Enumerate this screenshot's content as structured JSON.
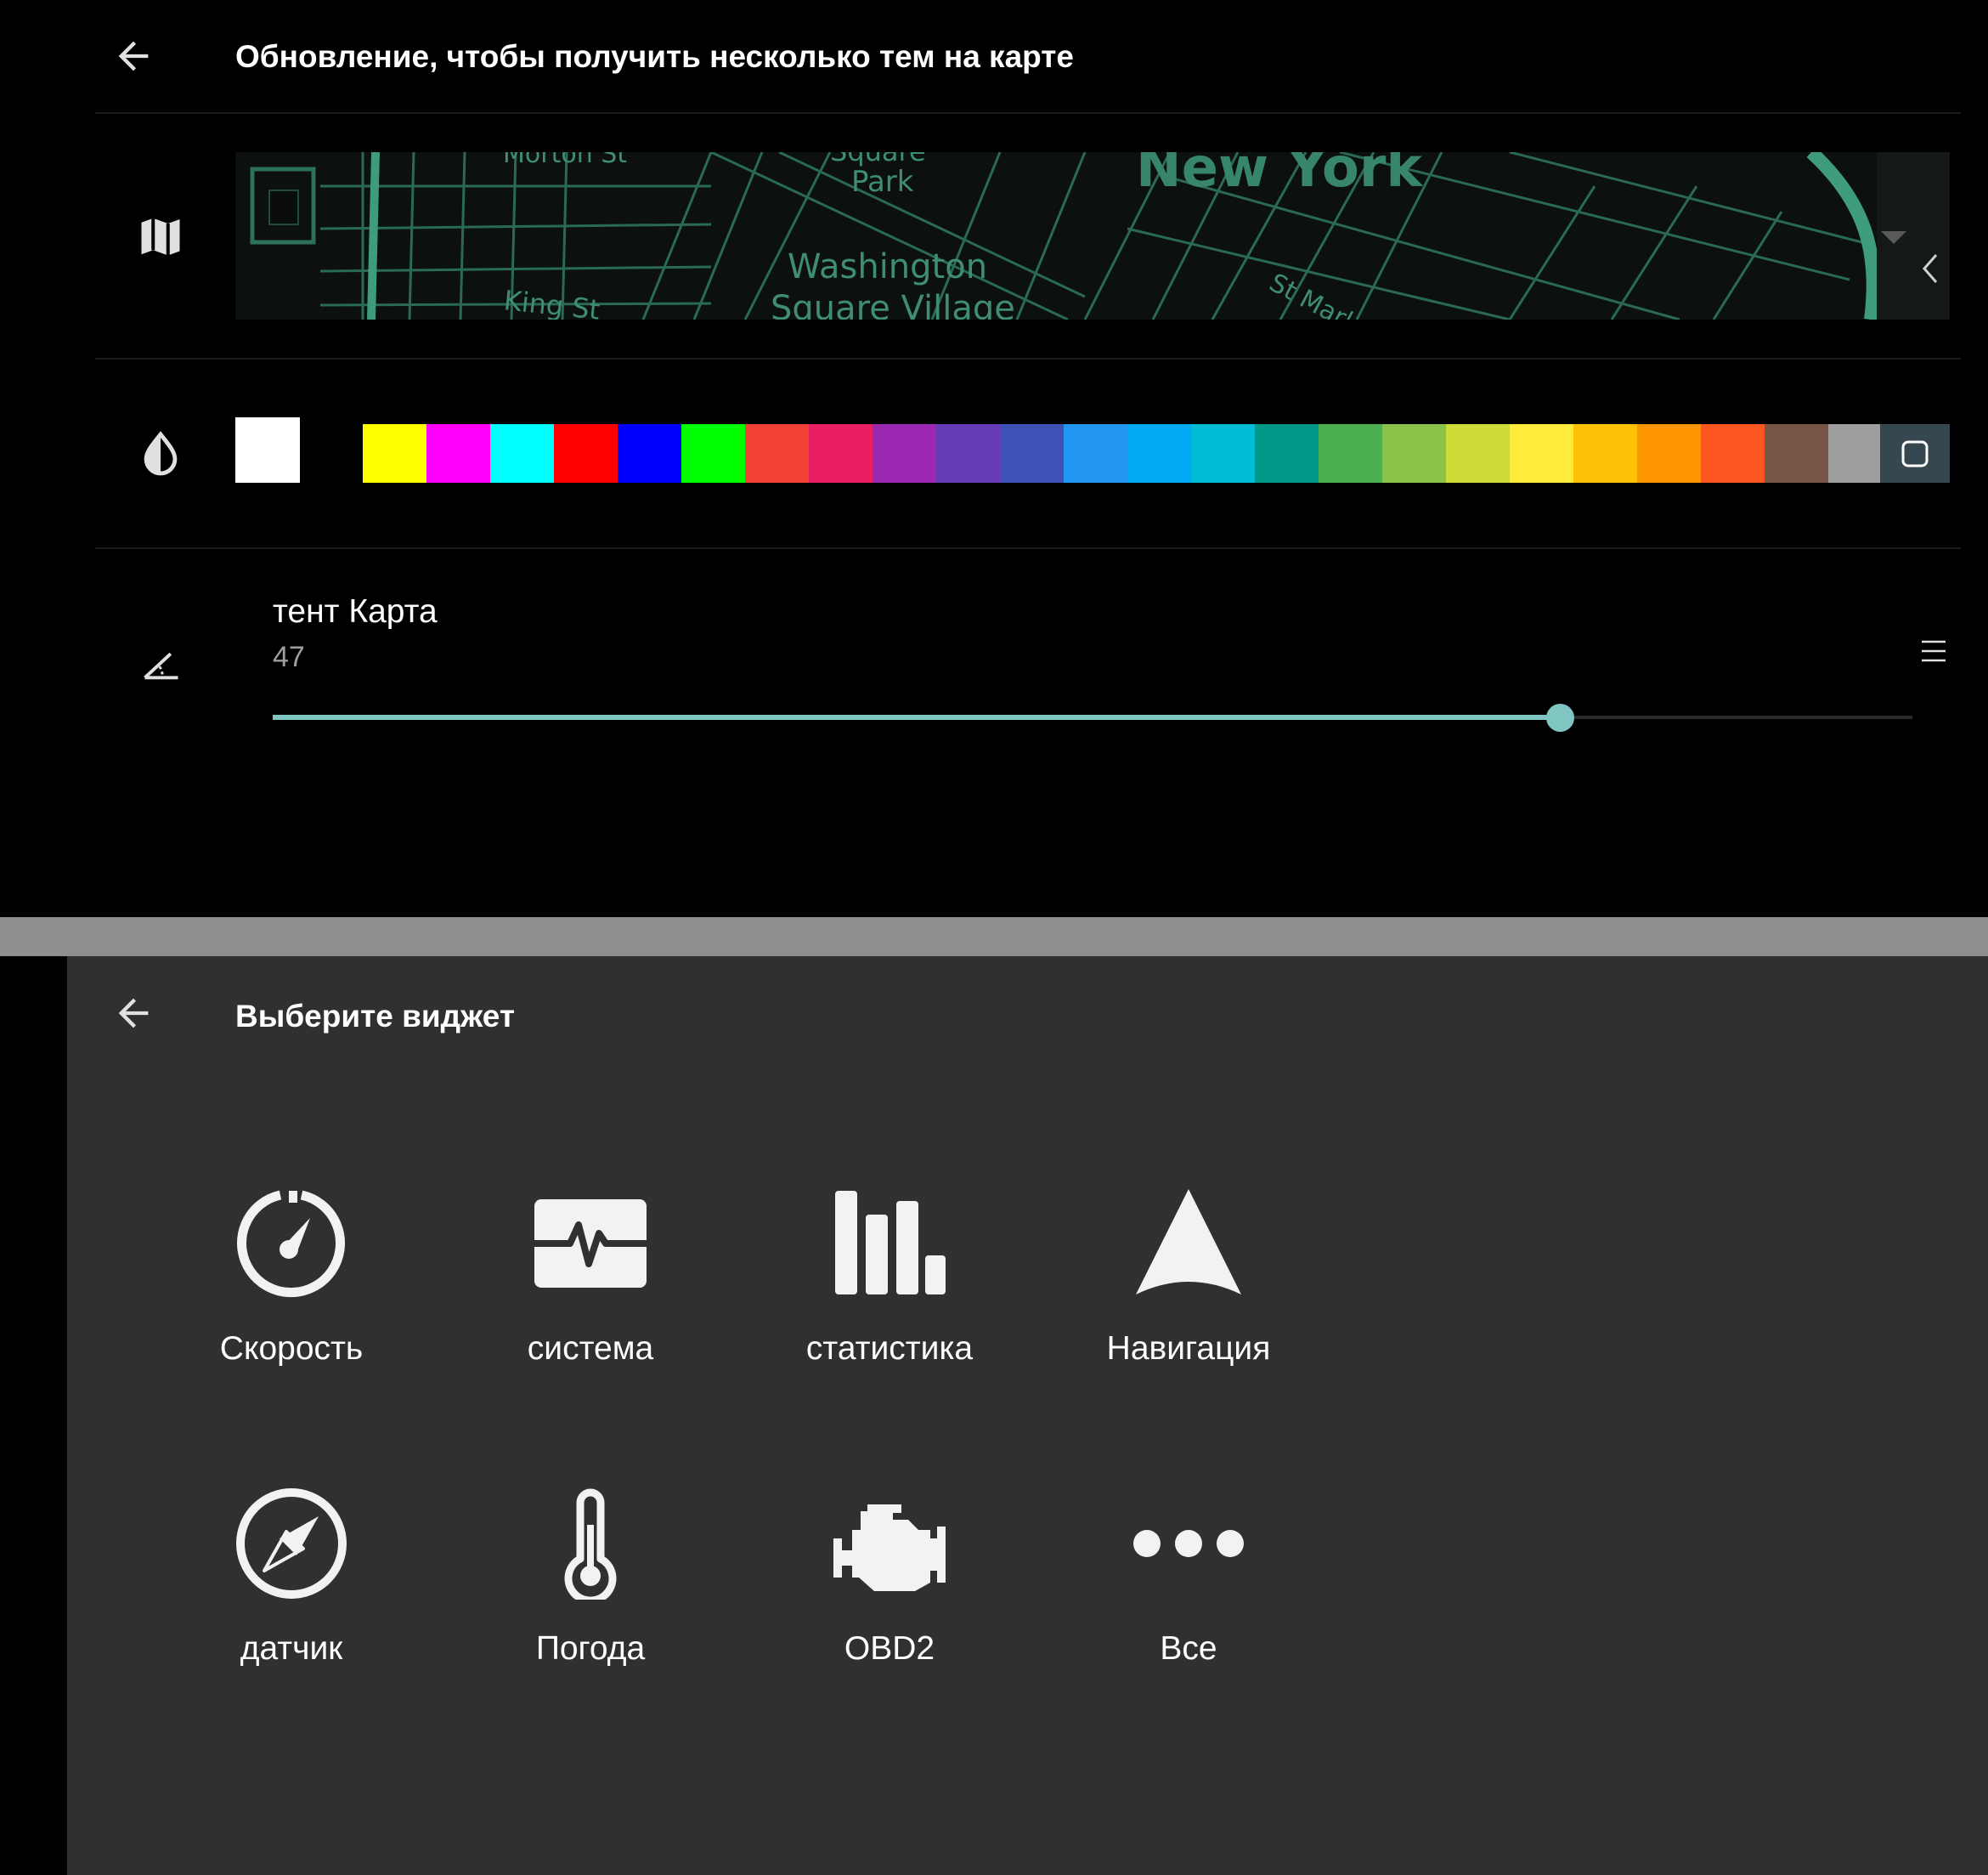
{
  "top_panel": {
    "title": "Обновление, чтобы получить несколько тем на карте",
    "back_icon": "arrow-left-icon",
    "map_row": {
      "icon": "map-icon",
      "labels": [
        "Square",
        "Park",
        "New York",
        "Washington",
        "Square Village",
        "King St",
        "St Marks",
        "Morton St"
      ]
    },
    "color_row": {
      "icon": "opacity-drop-icon",
      "selected_color": "#ffffff",
      "palette": [
        "#ffff00",
        "#ff00ff",
        "#00ffff",
        "#ff0000",
        "#0000ff",
        "#00ff00",
        "#f44336",
        "#e91e63",
        "#9c27b0",
        "#673ab7",
        "#3f51b5",
        "#2196f3",
        "#03a9f4",
        "#00bcd4",
        "#009688",
        "#4caf50",
        "#8bc34a",
        "#cddc39",
        "#ffeb3b",
        "#ffc107",
        "#ff9800",
        "#ff5722",
        "#795548",
        "#9e9e9e"
      ]
    },
    "tilt_setting": {
      "icon": "angle-icon",
      "title": "тент Карта",
      "value": "47",
      "value_fraction": 0.785,
      "accent": "#7fc6c2"
    }
  },
  "bottom_panel": {
    "title": "Выберите виджет",
    "back_icon": "arrow-left-icon",
    "background": "#303030",
    "widgets": [
      {
        "label": "Скорость",
        "icon": "speedometer-icon"
      },
      {
        "label": "система",
        "icon": "heartbeat-monitor-icon"
      },
      {
        "label": "статистика",
        "icon": "bar-chart-icon"
      },
      {
        "label": "Навигация",
        "icon": "navigation-arrow-icon"
      },
      {
        "label": "датчик",
        "icon": "compass-icon"
      },
      {
        "label": "Погода",
        "icon": "thermometer-icon"
      },
      {
        "label": "OBD2",
        "icon": "engine-icon"
      },
      {
        "label": "Все",
        "icon": "more-dots-icon"
      }
    ]
  }
}
